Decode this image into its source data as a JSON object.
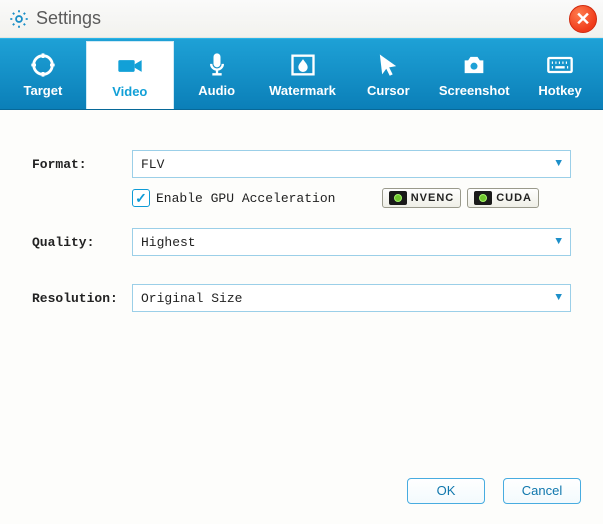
{
  "title": "Settings",
  "tabs": [
    {
      "label": "Target"
    },
    {
      "label": "Video"
    },
    {
      "label": "Audio"
    },
    {
      "label": "Watermark"
    },
    {
      "label": "Cursor"
    },
    {
      "label": "Screenshot"
    },
    {
      "label": "Hotkey"
    }
  ],
  "format": {
    "label": "Format:",
    "value": "FLV",
    "gpu_checkbox_checked": "✓",
    "gpu_label": "Enable GPU Acceleration",
    "badge_nvenc": "NVENC",
    "badge_cuda": "CUDA"
  },
  "quality": {
    "label": "Quality:",
    "value": "Highest"
  },
  "resolution": {
    "label": "Resolution:",
    "value": "Original Size"
  },
  "buttons": {
    "ok": "OK",
    "cancel": "Cancel"
  }
}
